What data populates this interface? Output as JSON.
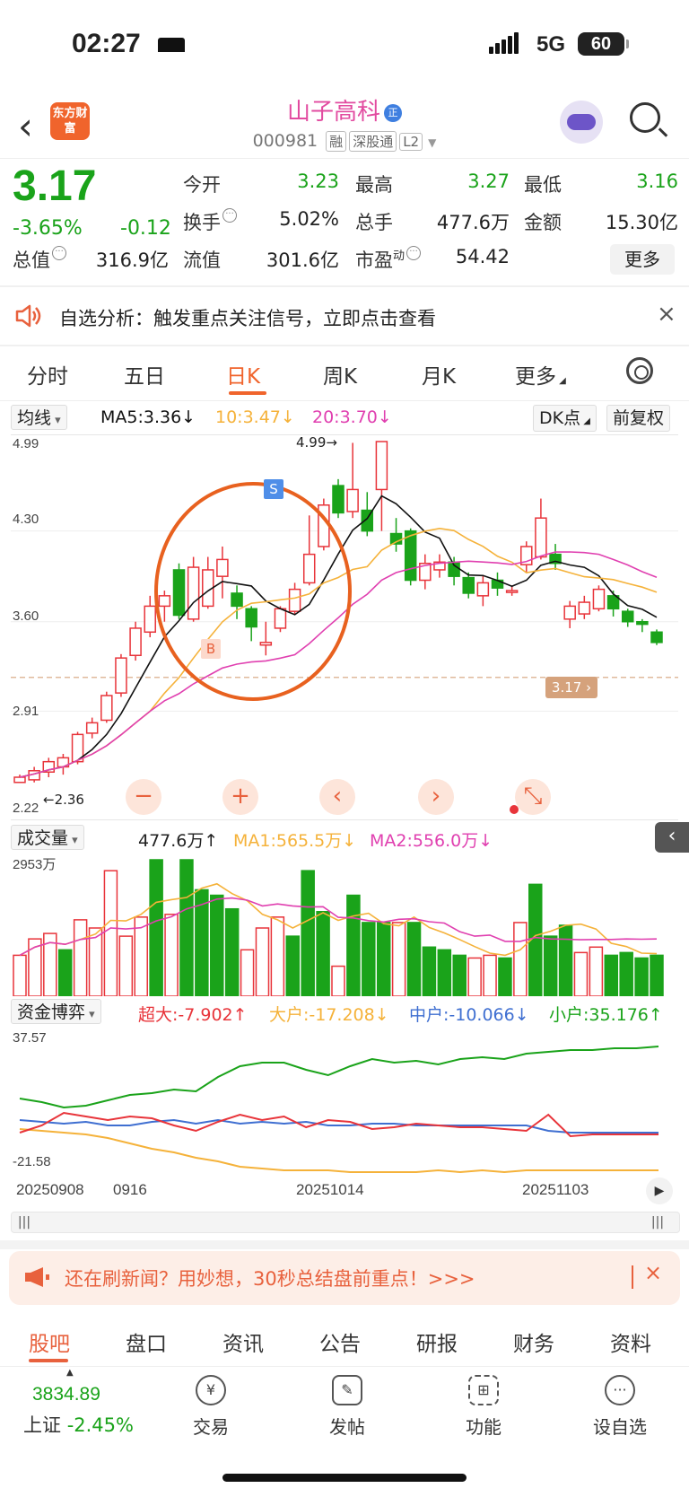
{
  "status_bar": {
    "time": "02:27",
    "network": "5G",
    "battery": "60"
  },
  "header": {
    "logo_text": "东方财富",
    "stock_name": "山子高科",
    "name_badge": "正",
    "code": "000981",
    "tags": [
      "融",
      "深股通",
      "L2"
    ]
  },
  "quote": {
    "price": "3.17",
    "change_pct": "-3.65%",
    "change": "-0.12",
    "fields": {
      "open_label": "今开",
      "open": "3.23",
      "high_label": "最高",
      "high": "3.27",
      "low_label": "最低",
      "low": "3.16",
      "turnover_label": "换手",
      "turnover": "5.02%",
      "volume_label": "总手",
      "volume": "477.6万",
      "amount_label": "金额",
      "amount": "15.30亿",
      "mktcap_label": "总值",
      "mktcap": "316.9亿",
      "float_label": "流值",
      "float": "301.6亿",
      "pe_label": "市盈",
      "pe_sup": "动",
      "pe": "54.42"
    },
    "more_button": "更多"
  },
  "notice": {
    "text": "自选分析：触发重点关注信号，立即点击查看"
  },
  "period_tabs": [
    "分时",
    "五日",
    "日K",
    "周K",
    "月K",
    "更多"
  ],
  "active_period": "日K",
  "ma_row": {
    "dropdown": "均线",
    "ma5": "MA5:3.36↓",
    "ma10": "10:3.47↓",
    "ma20": "20:3.70↓",
    "dk_button": "DK点",
    "adjust_button": "前复权"
  },
  "kline": {
    "y_labels": [
      "4.99",
      "4.30",
      "3.60",
      "2.91",
      "2.22"
    ],
    "high_marker": "4.99→",
    "low_marker": "←2.36",
    "current_price_tag": "3.17",
    "signal_b": "B",
    "signal_s": "S",
    "zoom_buttons": [
      "−",
      "+",
      "‹",
      "›",
      "⤡"
    ]
  },
  "volume": {
    "dropdown": "成交量",
    "value": "477.6万↑",
    "ma1": "MA1:565.5万↓",
    "ma2": "MA2:556.0万↓",
    "y_max": "2953万"
  },
  "fund_flow": {
    "dropdown": "资金博弈",
    "super_large": "超大:-7.902↑",
    "large": "大户:-17.208↓",
    "medium": "中户:-10.066↓",
    "small": "小户:35.176↑",
    "y_max": "37.57",
    "y_min": "-21.58"
  },
  "x_axis": {
    "labels": [
      "20250908",
      "0916",
      "20251014",
      "20251103"
    ]
  },
  "promo": {
    "text": "还在刷新闻？用妙想，30秒总结盘前重点！>>>"
  },
  "bottom_tabs": [
    "股吧",
    "盘口",
    "资讯",
    "公告",
    "研报",
    "财务",
    "资料"
  ],
  "active_bottom_tab": "股吧",
  "nav": {
    "index_value": "3834.89",
    "index_name": "上证",
    "index_change": "-2.45%",
    "items": [
      {
        "label": "交易",
        "icon": "trade-icon"
      },
      {
        "label": "发帖",
        "icon": "post-icon"
      },
      {
        "label": "功能",
        "icon": "apps-icon"
      },
      {
        "label": "设自选",
        "icon": "more-icon"
      }
    ]
  },
  "colors": {
    "up": "#e8343a",
    "down": "#1aa31a",
    "ma5": "#111111",
    "ma10": "#f5b23a",
    "ma20": "#e040b0",
    "accent": "#f0642c",
    "medium": "#3f6fd1"
  }
}
